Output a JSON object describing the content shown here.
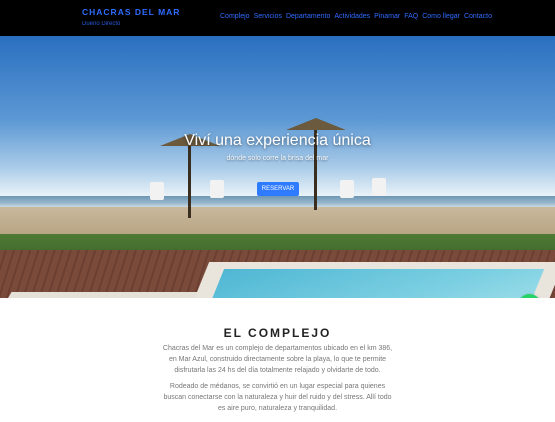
{
  "navbar": {
    "brand_title": "CHACRAS DEL MAR",
    "brand_subtitle": "Dueño Directo",
    "links": [
      "Complejo",
      "Servicios",
      "Departamento",
      "Actividades",
      "Pinamar",
      "FAQ",
      "Como llegar",
      "Contacto"
    ]
  },
  "hero": {
    "title": "Viví una experiencia única",
    "subtitle": "dónde solo corre la brisa del mar",
    "button": "RESERVAR"
  },
  "complejo": {
    "title": "EL COMPLEJO",
    "paragraph1": "Chacras del Mar es un complejo de departamentos ubicado en el km 386, en Mar Azul, construido directamente sobre la playa, lo que te permite disfrutarla las 24 hs del día totalmente relajado y olvidarte de todo.",
    "paragraph2": "Rodeado de médanos, se convirtió en un lugar especial para quienes buscan conectarse con la naturaleza y huir del ruido y del stress. Allí todo es aire puro, naturaleza y tranquilidad."
  },
  "widgets": {
    "whatsapp_icon": "whatsapp-icon"
  },
  "colors": {
    "nav_bg": "#000000",
    "link": "#2f6bff",
    "button": "#2f7bff",
    "whatsapp": "#25d366"
  }
}
